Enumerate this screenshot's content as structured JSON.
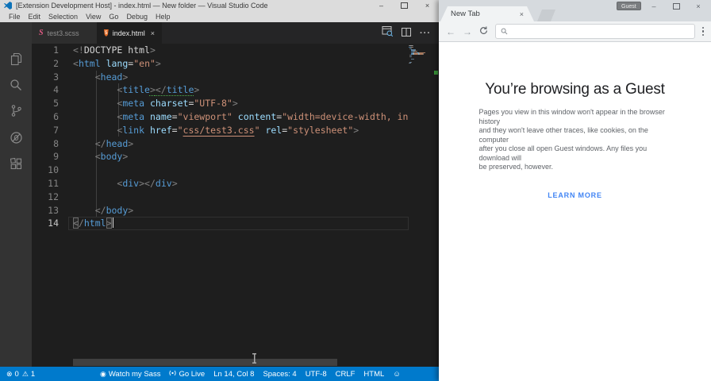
{
  "colors": {
    "accent": "#007acc",
    "editor_bg": "#1e1e1e",
    "tag_blue": "#569cd6",
    "attr_blue": "#9cdcfe",
    "string_orange": "#ce9178",
    "punct_gray": "#808080",
    "plain": "#d4d4d4",
    "squiggle_green": "#4fae4f",
    "learn_blue": "#4285f4",
    "sass_pink": "#e05a83",
    "html_orange": "#e36b26"
  },
  "glyphs": {
    "error": "⊗",
    "warning": "⚠",
    "eye": "◉",
    "smiley": "☺",
    "back": "←",
    "forward": "→",
    "minimize": "–",
    "close": "×",
    "more_h": "···",
    "tab_close": "×",
    "sass": "S",
    "html5": "5"
  },
  "vscode": {
    "title": "[Extension Development Host] - index.html — New folder — Visual Studio Code",
    "menu": [
      "File",
      "Edit",
      "Selection",
      "View",
      "Go",
      "Debug",
      "Help"
    ],
    "tabs": [
      {
        "label": "test3.scss"
      },
      {
        "label": "index.html"
      }
    ],
    "editor": {
      "lines": [
        {
          "n": "1",
          "toks": [
            [
              "p",
              "<!"
            ],
            [
              "w",
              "DOCTYPE html"
            ],
            [
              "p",
              ">"
            ]
          ]
        },
        {
          "n": "2",
          "toks": [
            [
              "p",
              "<"
            ],
            [
              "t",
              "html"
            ],
            [
              "w",
              " "
            ],
            [
              "a",
              "lang"
            ],
            [
              "w",
              "="
            ],
            [
              "s",
              "\"en\""
            ],
            [
              "p",
              ">"
            ]
          ]
        },
        {
          "n": "3",
          "toks": [
            [
              "w",
              "    "
            ],
            [
              "p",
              "<"
            ],
            [
              "t",
              "head"
            ],
            [
              "p",
              ">"
            ]
          ]
        },
        {
          "n": "4",
          "toks": [
            [
              "w",
              "        "
            ],
            [
              "p",
              "<"
            ],
            [
              "t",
              "title"
            ],
            [
              "p sq",
              ">"
            ],
            [
              "p sq",
              "</"
            ],
            [
              "t sq",
              "title"
            ],
            [
              "p",
              ">"
            ]
          ]
        },
        {
          "n": "5",
          "toks": [
            [
              "w",
              "        "
            ],
            [
              "p",
              "<"
            ],
            [
              "t",
              "meta"
            ],
            [
              "w",
              " "
            ],
            [
              "a",
              "charset"
            ],
            [
              "w",
              "="
            ],
            [
              "s",
              "\"UTF-8\""
            ],
            [
              "p",
              ">"
            ]
          ]
        },
        {
          "n": "6",
          "toks": [
            [
              "w",
              "        "
            ],
            [
              "p",
              "<"
            ],
            [
              "t",
              "meta"
            ],
            [
              "w",
              " "
            ],
            [
              "a",
              "name"
            ],
            [
              "w",
              "="
            ],
            [
              "s",
              "\"viewport\""
            ],
            [
              "w",
              " "
            ],
            [
              "a",
              "content"
            ],
            [
              "w",
              "="
            ],
            [
              "s",
              "\"width=device-width, in"
            ]
          ]
        },
        {
          "n": "7",
          "toks": [
            [
              "w",
              "        "
            ],
            [
              "p",
              "<"
            ],
            [
              "t",
              "link"
            ],
            [
              "w",
              " "
            ],
            [
              "a",
              "href"
            ],
            [
              "w",
              "="
            ],
            [
              "s",
              "\""
            ],
            [
              "s lnk",
              "css/test3.css"
            ],
            [
              "s",
              "\""
            ],
            [
              "w",
              " "
            ],
            [
              "a",
              "rel"
            ],
            [
              "w",
              "="
            ],
            [
              "s",
              "\"stylesheet\""
            ],
            [
              "p",
              ">"
            ]
          ]
        },
        {
          "n": "8",
          "toks": [
            [
              "w",
              "    "
            ],
            [
              "p",
              "</"
            ],
            [
              "t",
              "head"
            ],
            [
              "p",
              ">"
            ]
          ]
        },
        {
          "n": "9",
          "toks": [
            [
              "w",
              "    "
            ],
            [
              "p",
              "<"
            ],
            [
              "t",
              "body"
            ],
            [
              "p",
              ">"
            ]
          ]
        },
        {
          "n": "10",
          "toks": []
        },
        {
          "n": "11",
          "toks": [
            [
              "w",
              "        "
            ],
            [
              "p",
              "<"
            ],
            [
              "t",
              "div"
            ],
            [
              "p",
              ">"
            ],
            [
              "p",
              "</"
            ],
            [
              "t",
              "div"
            ],
            [
              "p",
              ">"
            ]
          ]
        },
        {
          "n": "12",
          "toks": []
        },
        {
          "n": "13",
          "toks": [
            [
              "w",
              "    "
            ],
            [
              "p",
              "</"
            ],
            [
              "t",
              "body"
            ],
            [
              "p",
              ">"
            ]
          ]
        },
        {
          "n": "14",
          "toks": [
            [
              "p bm",
              "<"
            ],
            [
              "p",
              "/"
            ],
            [
              "t",
              "html"
            ],
            [
              "p bm",
              ">"
            ]
          ],
          "cursor": true,
          "active": true
        }
      ]
    },
    "status_bar": {
      "errors": "0",
      "warnings": "1",
      "watch": "Watch my Sass",
      "golive": "Go Live",
      "position": "Ln 14, Col 8",
      "spaces": "Spaces: 4",
      "encoding": "UTF-8",
      "eol": "CRLF",
      "language": "HTML"
    }
  },
  "browser": {
    "profile_badge": "Guest",
    "tab": {
      "title": "New Tab"
    },
    "toolbar": {
      "address_value": ""
    },
    "page": {
      "heading": "You’re browsing as a Guest",
      "body": "Pages you view in this window won't appear in the browser history\nand they won't leave other traces, like cookies, on the computer\nafter you close all open Guest windows. Any files you download will\nbe preserved, however.",
      "learn_more": "LEARN MORE"
    }
  }
}
